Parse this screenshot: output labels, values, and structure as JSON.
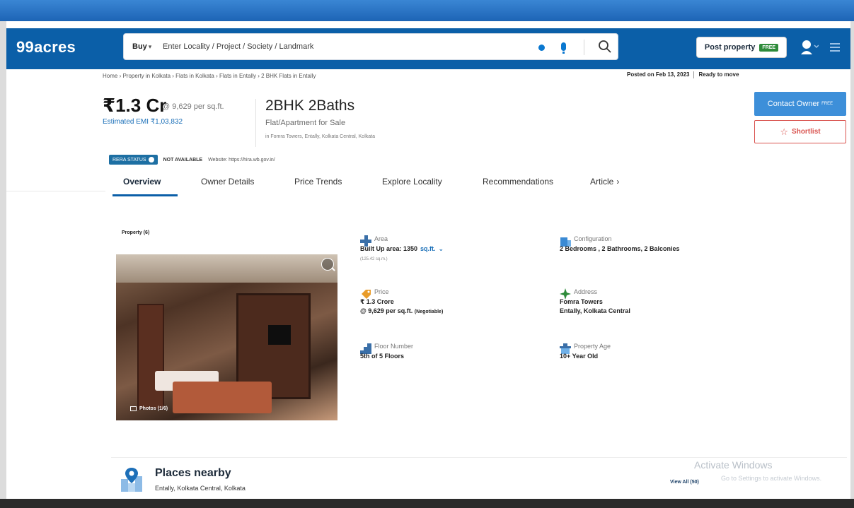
{
  "header": {
    "logo": "99acres",
    "search": {
      "buy_label": "Buy",
      "placeholder": "Enter Locality / Project / Society / Landmark"
    },
    "post_property": {
      "label": "Post property",
      "badge": "FREE"
    },
    "icons": [
      "location-icon",
      "mic-icon",
      "search-icon",
      "user-icon",
      "menu-icon"
    ]
  },
  "breadcrumb": "Home › Property in Kolkata › Flats in Kolkata › Flats in Entally › 2 BHK Flats in Entally",
  "posted": {
    "date": "Posted on Feb 13, 2023",
    "status": "Ready to move"
  },
  "listing": {
    "price": "₹1.3 Cr",
    "per_sqft": "@ 9,629 per sq.ft.",
    "emi": "Estimated EMI ₹1,03,832",
    "title": "2BHK 2Baths",
    "subtitle": "Flat/Apartment for Sale",
    "location": "in Fomra Towers, Entally, Kolkata Central, Kolkata"
  },
  "actions": {
    "contact_owner": "Contact Owner",
    "contact_badge": "FREE",
    "shortlist": "Shortlist"
  },
  "rera": {
    "badge": "RERA STATUS",
    "status": "NOT AVAILABLE",
    "website": "Website: https://hira.wb.gov.in/"
  },
  "tabs": [
    {
      "label": "Overview",
      "active": true
    },
    {
      "label": "Owner Details",
      "active": false
    },
    {
      "label": "Price Trends",
      "active": false
    },
    {
      "label": "Explore Locality",
      "active": false
    },
    {
      "label": "Recommendations",
      "active": false
    },
    {
      "label": "Article",
      "active": false
    }
  ],
  "gallery": {
    "count_label": "Property (6)",
    "photos_label": "Photos (1/6)"
  },
  "details": {
    "area": {
      "label": "Area",
      "value": "Built Up area: 1350",
      "unit": "sq.ft.",
      "sub": "(125.42 sq.m.)"
    },
    "configuration": {
      "label": "Configuration",
      "value": "2 Bedrooms , 2 Bathrooms, 2 Balconies"
    },
    "price": {
      "label": "Price",
      "value": "₹ 1.3 Crore",
      "value2": "@ 9,629 per sq.ft.",
      "note": "(Negotiable)"
    },
    "address": {
      "label": "Address",
      "value": "Fomra Towers",
      "value2": "Entally, Kolkata Central"
    },
    "floor": {
      "label": "Floor Number",
      "value": "5th of 5 Floors"
    },
    "age": {
      "label": "Property Age",
      "value": "10+ Year Old"
    }
  },
  "places": {
    "title": "Places nearby",
    "subtitle": "Entally, Kolkata Central, Kolkata",
    "view_all": "View All (50)"
  },
  "watermark": {
    "title": "Activate Windows",
    "subtitle": "Go to Settings to activate Windows."
  },
  "colors": {
    "brand_blue": "#0b5fa8",
    "contact_blue": "#3d8fd9",
    "shortlist_red": "#d9534f",
    "link_blue": "#1a6fb8"
  }
}
